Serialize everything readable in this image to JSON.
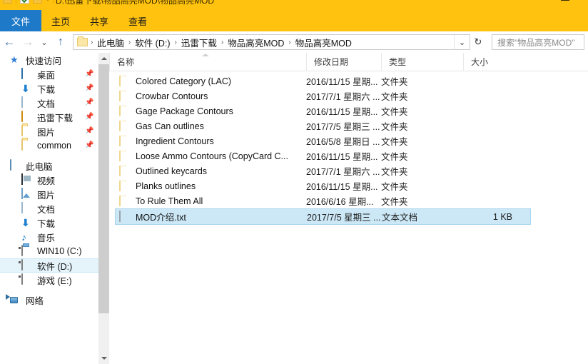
{
  "window": {
    "title": "D:\\迅雷下载\\物品高亮MOD\\物品高亮MOD",
    "titlebar_color": "#ffc20e",
    "accent_color": "#1e7ac8"
  },
  "ribbon": {
    "tabs": [
      {
        "label": "文件",
        "active": true
      },
      {
        "label": "主页",
        "active": false
      },
      {
        "label": "共享",
        "active": false
      },
      {
        "label": "查看",
        "active": false
      }
    ]
  },
  "nav": {
    "back": "←",
    "forward": "→",
    "recent": "⌄",
    "up": "↑",
    "dropdown": "⌄",
    "refresh": "↻",
    "breadcrumbs": [
      "此电脑",
      "软件 (D:)",
      "迅雷下载",
      "物品高亮MOD",
      "物品高亮MOD"
    ],
    "separator": "›"
  },
  "search": {
    "placeholder": "搜索\"物品高亮MOD\""
  },
  "sidebar": {
    "groups": [
      {
        "header": {
          "label": "快速访问",
          "icon": "star-icon"
        },
        "items": [
          {
            "label": "桌面",
            "icon": "desktop-icon",
            "pinned": true
          },
          {
            "label": "下载",
            "icon": "download-icon",
            "pinned": true
          },
          {
            "label": "文档",
            "icon": "documents-icon",
            "pinned": true
          },
          {
            "label": "迅雷下载",
            "icon": "thunder-icon",
            "pinned": true
          },
          {
            "label": "图片",
            "icon": "folder-icon",
            "pinned": true
          },
          {
            "label": "common",
            "icon": "folder-icon",
            "pinned": true
          }
        ]
      },
      {
        "header": {
          "label": "此电脑",
          "icon": "this-pc-icon"
        },
        "items": [
          {
            "label": "视频",
            "icon": "video-icon",
            "pinned": false
          },
          {
            "label": "图片",
            "icon": "pictures-icon",
            "pinned": false
          },
          {
            "label": "文档",
            "icon": "documents-icon",
            "pinned": false
          },
          {
            "label": "下载",
            "icon": "download-icon",
            "pinned": false
          },
          {
            "label": "音乐",
            "icon": "music-icon",
            "pinned": false
          },
          {
            "label": "WIN10 (C:)",
            "icon": "drive-system-icon",
            "pinned": false
          },
          {
            "label": "软件 (D:)",
            "icon": "drive-icon",
            "pinned": false,
            "selected": true
          },
          {
            "label": "游戏 (E:)",
            "icon": "drive-icon",
            "pinned": false
          }
        ]
      },
      {
        "header": {
          "label": "网络",
          "icon": "network-icon"
        },
        "items": []
      }
    ],
    "pin_glyph": "📌"
  },
  "filelist": {
    "columns": [
      {
        "key": "name",
        "label": "名称"
      },
      {
        "key": "date",
        "label": "修改日期"
      },
      {
        "key": "type",
        "label": "类型"
      },
      {
        "key": "size",
        "label": "大小"
      }
    ],
    "sorted_by": "名称",
    "sort_direction": "ascending",
    "rows": [
      {
        "name": "Colored Category (LAC)",
        "date": "2016/11/15 星期...",
        "type": "文件夹",
        "size": "",
        "icon": "folder-icon",
        "selected": false
      },
      {
        "name": "Crowbar Contours",
        "date": "2017/7/1 星期六 ...",
        "type": "文件夹",
        "size": "",
        "icon": "folder-icon",
        "selected": false
      },
      {
        "name": "Gage Package Contours",
        "date": "2016/11/15 星期...",
        "type": "文件夹",
        "size": "",
        "icon": "folder-icon",
        "selected": false
      },
      {
        "name": "Gas Can outlines",
        "date": "2017/7/5 星期三 ...",
        "type": "文件夹",
        "size": "",
        "icon": "folder-icon",
        "selected": false
      },
      {
        "name": "Ingredient Contours",
        "date": "2016/5/8 星期日 ...",
        "type": "文件夹",
        "size": "",
        "icon": "folder-icon",
        "selected": false
      },
      {
        "name": "Loose Ammo Contours (CopyCard C...",
        "date": "2016/11/15 星期...",
        "type": "文件夹",
        "size": "",
        "icon": "folder-icon",
        "selected": false
      },
      {
        "name": "Outlined keycards",
        "date": "2017/7/1 星期六 ...",
        "type": "文件夹",
        "size": "",
        "icon": "folder-icon",
        "selected": false
      },
      {
        "name": "Planks outlines",
        "date": "2016/11/15 星期...",
        "type": "文件夹",
        "size": "",
        "icon": "folder-icon",
        "selected": false
      },
      {
        "name": "To Rule Them All",
        "date": "2016/6/16 星期...",
        "type": "文件夹",
        "size": "",
        "icon": "folder-icon",
        "selected": false
      },
      {
        "name": "MOD介绍.txt",
        "date": "2017/7/5 星期三 ...",
        "type": "文本文档",
        "size": "1 KB",
        "icon": "text-file-icon",
        "selected": true
      }
    ]
  }
}
